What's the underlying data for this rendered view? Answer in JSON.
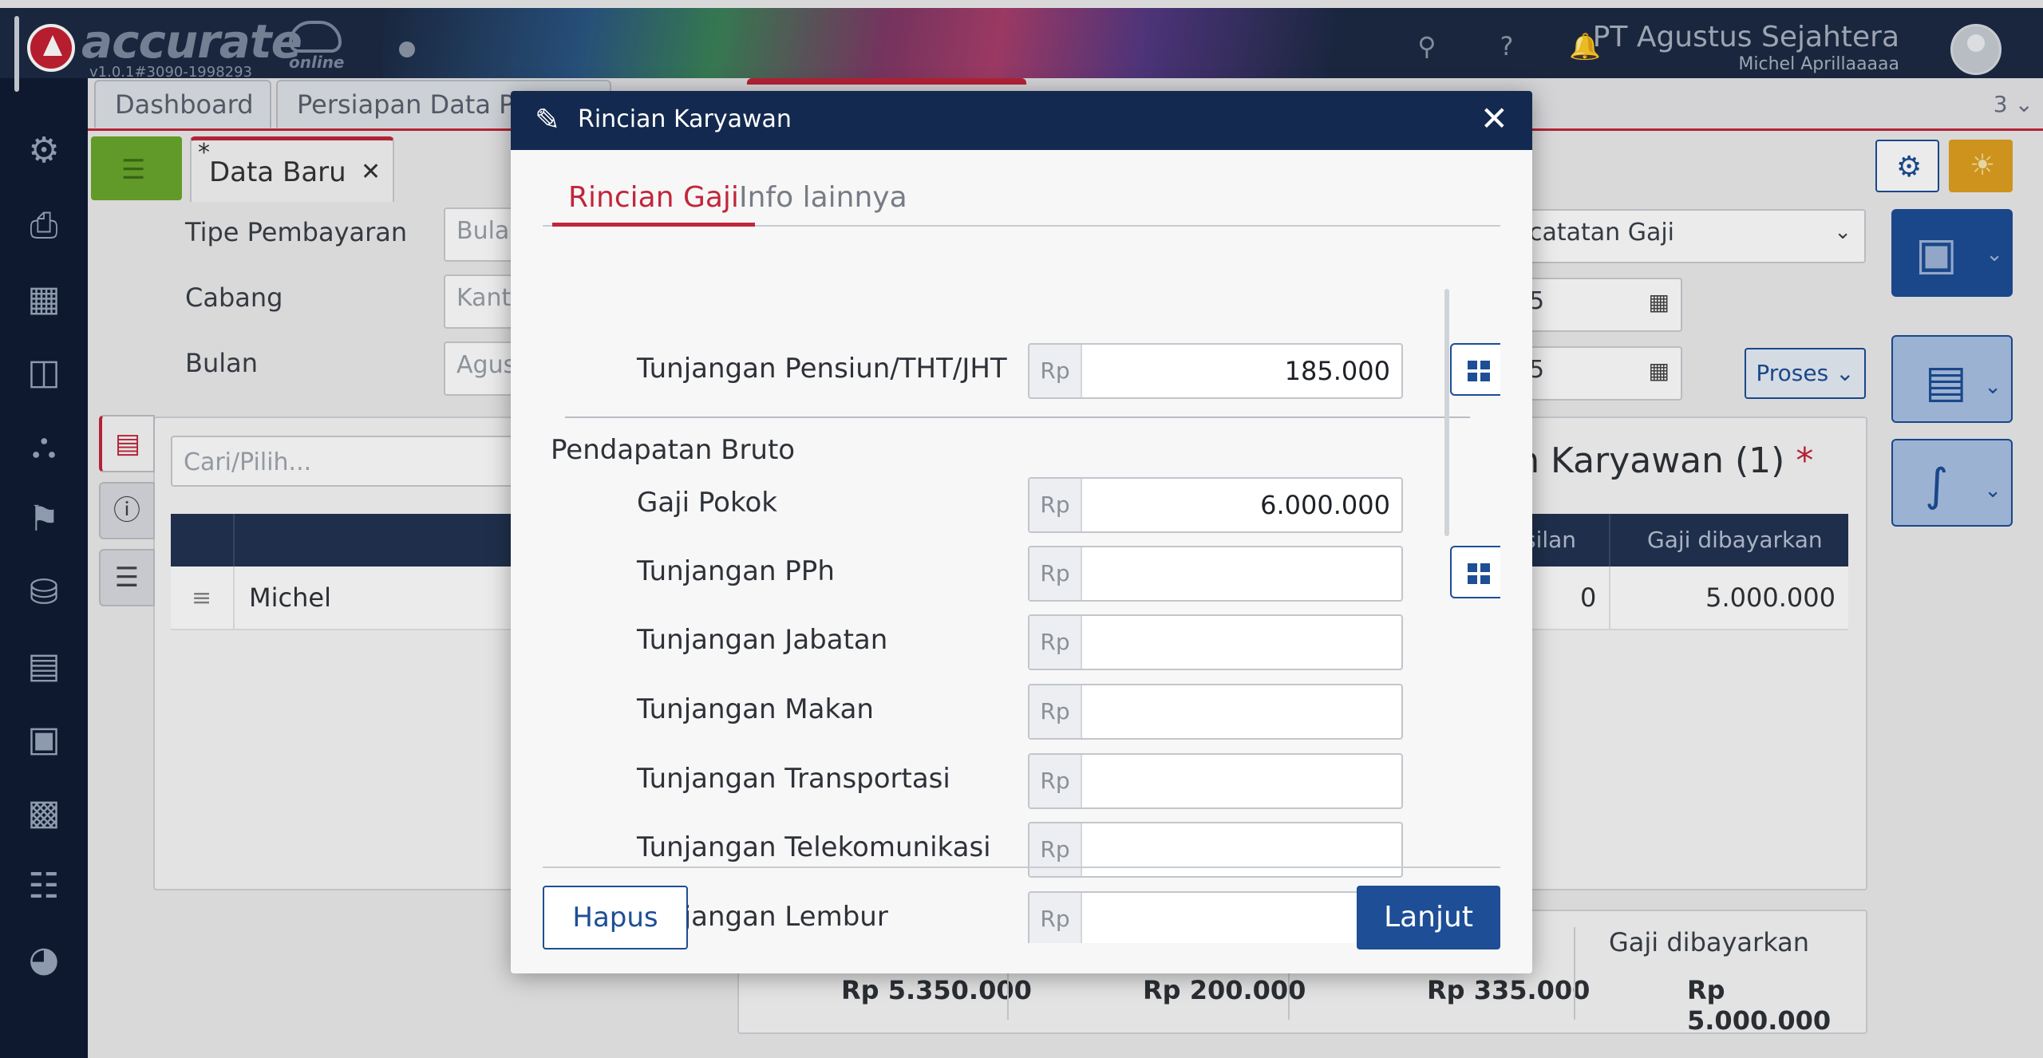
{
  "app": {
    "brand": "accurate",
    "brand_suffix": "online",
    "version": "v1.0.1#3090-1998293",
    "company": "PT Agustus Sejahtera",
    "user": "Michel Aprillaaaaa",
    "accent_color": "#c2263a",
    "header_color": "#13294f"
  },
  "sidebar": {
    "icons": [
      "gear-icon",
      "fax-icon",
      "building-icon",
      "book-icon",
      "bank-icon",
      "money-tag-icon",
      "cart-icon",
      "trolley-icon",
      "factory-icon",
      "conveyor-icon",
      "tax-icon",
      "chart-icon"
    ]
  },
  "module_tabs": {
    "dashboard": "Dashboard",
    "persiapan": "Persiapan Data Pe",
    "count": "3"
  },
  "doc_tab": {
    "star": "*",
    "label": "Data Baru",
    "close": "✕"
  },
  "background_form": {
    "tipe_pembayaran_label": "Tipe Pembayaran",
    "tipe_pembayaran_value": "Bula",
    "cabang_label": "Cabang",
    "cabang_value": "Kant",
    "bulan_label": "Bulan",
    "bulan_value": "Agus",
    "pencatatan_value": "catatan Gaji",
    "date1_value": "5",
    "date2_value": "5",
    "proses_button": "Proses",
    "section_title": "ian Karyawan (1)",
    "required_mark": "*",
    "search_placeholder": "Cari/Pilih...",
    "grid_header_col1": "silan",
    "grid_header_col2": "Gaji dibayarkan",
    "grid_row_name": "Michel",
    "grid_row_val1": "0",
    "grid_row_val2": "5.000.000",
    "totals_header": "Gaji dibayarkan",
    "total1": "Rp 5.350.000",
    "total2": "Rp 200.000",
    "total3": "Rp 335.000",
    "total4": "Rp 5.000.000"
  },
  "modal": {
    "title": "Rincian Karyawan",
    "close": "✕",
    "tabs": [
      {
        "label": "Rincian Gaji",
        "active": true
      },
      {
        "label": "Info lainnya",
        "active": false
      }
    ],
    "currency": "Rp",
    "top_row": {
      "label": "Tunjangan Pensiun/THT/JHT",
      "value": "185.000"
    },
    "section": "Pendapatan Bruto",
    "rows": [
      {
        "label": "Gaji Pokok",
        "value": "6.000.000"
      },
      {
        "label": "Tunjangan PPh",
        "value": ""
      },
      {
        "label": "Tunjangan Jabatan",
        "value": ""
      },
      {
        "label": "Tunjangan Makan",
        "value": ""
      },
      {
        "label": "Tunjangan Transportasi",
        "value": ""
      },
      {
        "label": "Tunjangan Telekomunikasi",
        "value": ""
      },
      {
        "label": "Tunjangan Lembur",
        "value": ""
      }
    ],
    "hapus_button": "Hapus",
    "lanjut_button": "Lanjut"
  }
}
